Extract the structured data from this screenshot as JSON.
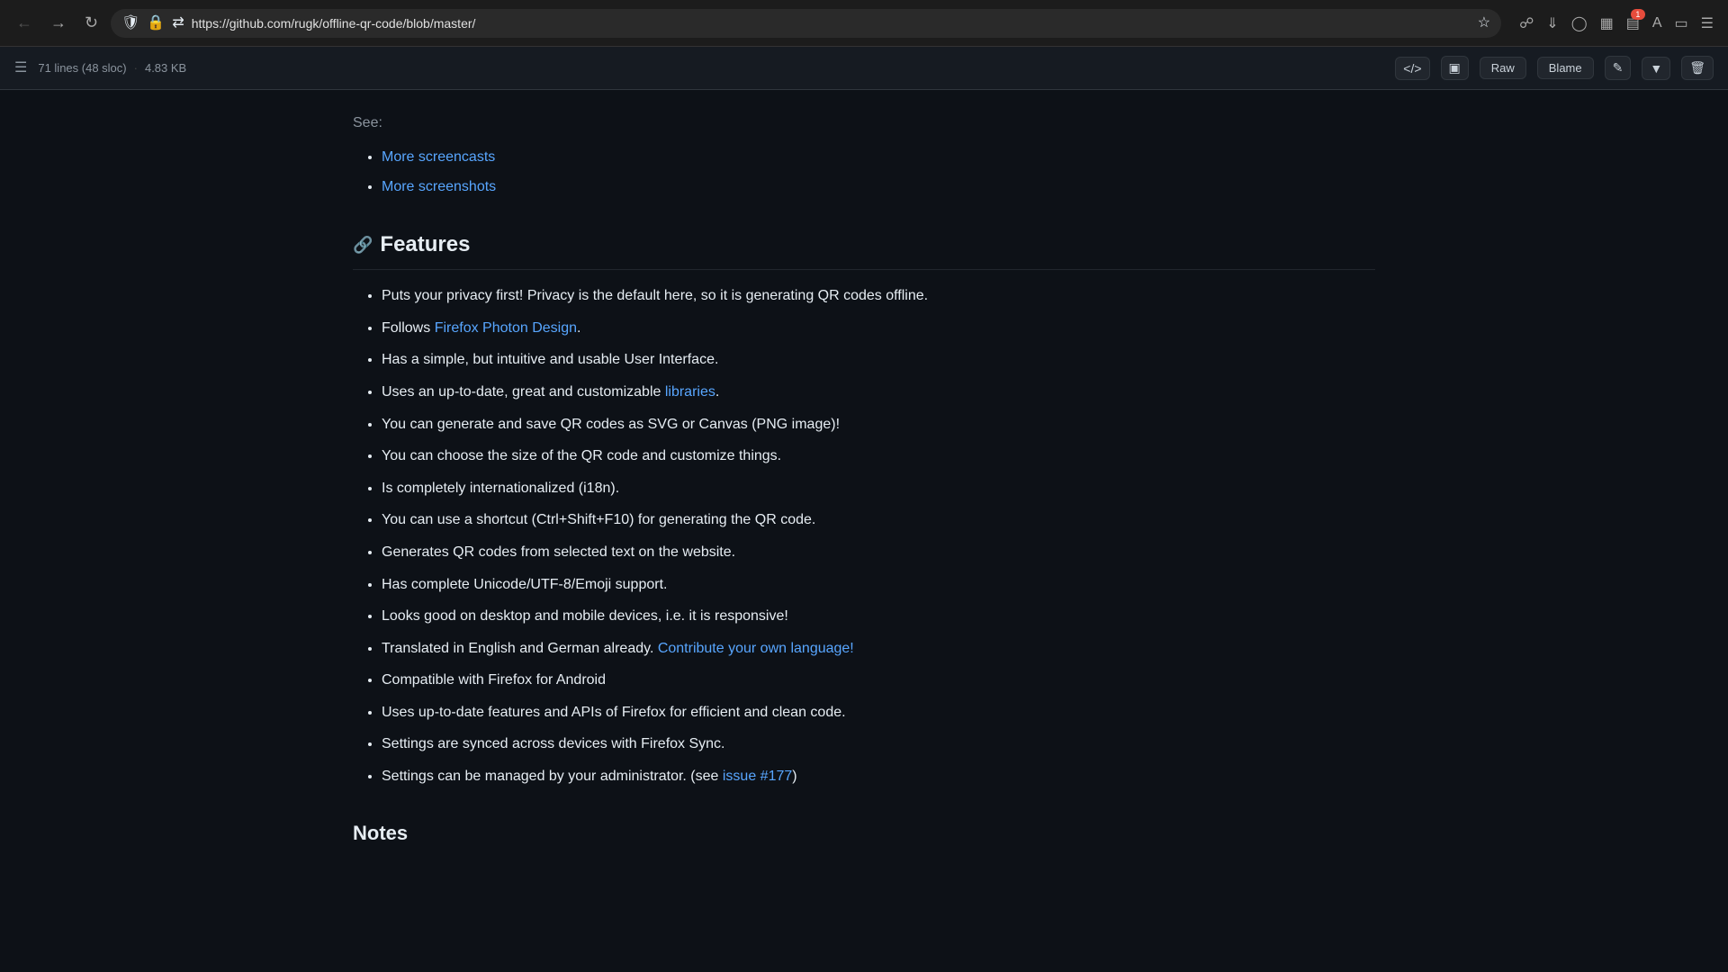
{
  "browser": {
    "url": "https://github.com/rugk/offline-qr-code/blob/master/",
    "badge_count": "1"
  },
  "toolbar": {
    "lines_info": "71 lines (48 sloc)",
    "size_info": "4.83 KB",
    "raw_label": "Raw",
    "blame_label": "Blame"
  },
  "content": {
    "see_label": "See:",
    "links": [
      {
        "text": "More screencasts",
        "href": "#"
      },
      {
        "text": "More screenshots",
        "href": "#"
      }
    ],
    "features_heading": "Features",
    "features": [
      {
        "text": "Puts your privacy first! Privacy is the default here, so it is generating QR codes offline.",
        "link": null
      },
      {
        "text_before": "Follows ",
        "link_text": "Firefox Photon Design",
        "link_href": "#",
        "text_after": "."
      },
      {
        "text": "Has a simple, but intuitive and usable User Interface.",
        "link": null
      },
      {
        "text_before": "Uses an up-to-date, great and customizable ",
        "link_text": "libraries",
        "link_href": "#",
        "text_after": "."
      },
      {
        "text": "You can generate and save QR codes as SVG or Canvas (PNG image)!",
        "link": null
      },
      {
        "text": "You can choose the size of the QR code and customize things.",
        "link": null
      },
      {
        "text": "Is completely internationalized (i18n).",
        "link": null
      },
      {
        "text": "You can use a shortcut (Ctrl+Shift+F10) for generating the QR code.",
        "link": null
      },
      {
        "text": "Generates QR codes from selected text on the website.",
        "link": null
      },
      {
        "text": "Has complete Unicode/UTF-8/Emoji support.",
        "link": null
      },
      {
        "text": "Looks good on desktop and mobile devices, i.e. it is responsive!",
        "link": null
      },
      {
        "text_before": "Translated in English and German already. ",
        "link_text": "Contribute your own language!",
        "link_href": "#",
        "text_after": ""
      },
      {
        "text": "Compatible with Firefox for Android",
        "link": null
      },
      {
        "text": "Uses up-to-date features and APIs of Firefox for efficient and clean code.",
        "link": null
      },
      {
        "text": "Settings are synced across devices with Firefox Sync.",
        "link": null
      },
      {
        "text_before": "Settings can be managed by your administrator. (see ",
        "link_text": "issue #177",
        "link_href": "#",
        "text_after": ")"
      }
    ],
    "notes_heading": "Notes"
  }
}
